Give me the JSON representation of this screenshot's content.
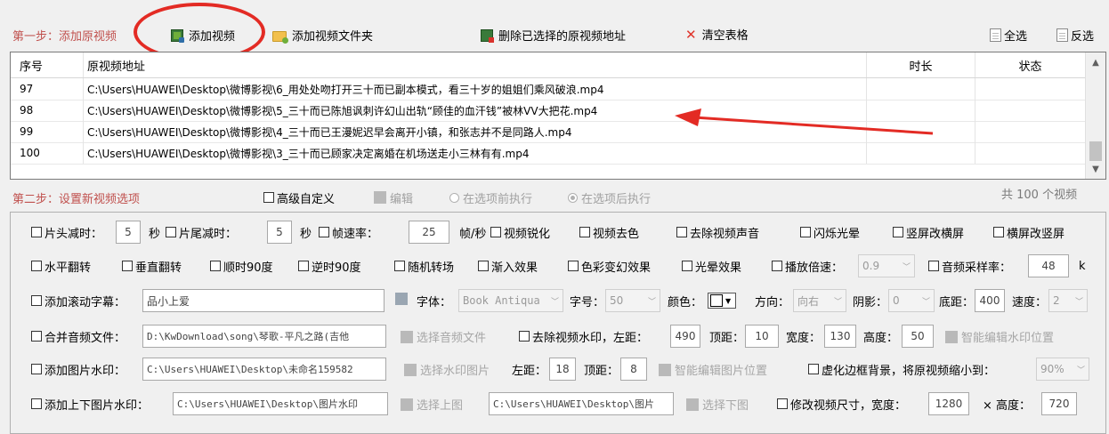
{
  "toolbar": {
    "step1_label": "第一步：添加原视频",
    "add_video": "添加视频",
    "add_folder": "添加视频文件夹",
    "delete_selected": "删除已选择的原视频地址",
    "clear_table": "清空表格",
    "select_all": "全选",
    "invert": "反选"
  },
  "table": {
    "headers": {
      "index": "序号",
      "path": "原视频地址",
      "duration": "时长",
      "status": "状态"
    },
    "rows": [
      {
        "index": "97",
        "path": "C:\\Users\\HUAWEI\\Desktop\\微博影视\\6_用处处吻打开三十而已副本模式，看三十岁的姐姐们乘风破浪.mp4",
        "duration": "",
        "status": ""
      },
      {
        "index": "98",
        "path": "C:\\Users\\HUAWEI\\Desktop\\微博影视\\5_三十而已陈旭讽刺许幻山出轨“顾佳的血汗钱”被林VV大把花.mp4",
        "duration": "",
        "status": ""
      },
      {
        "index": "99",
        "path": "C:\\Users\\HUAWEI\\Desktop\\微博影视\\4_三十而已王漫妮迟早会离开小镇，和张志并不是同路人.mp4",
        "duration": "",
        "status": ""
      },
      {
        "index": "100",
        "path": "C:\\Users\\HUAWEI\\Desktop\\微博影视\\3_三十而已顾家决定离婚在机场送走小三林有有.mp4",
        "duration": "",
        "status": ""
      }
    ]
  },
  "step2": {
    "label": "第二步：设置新视频选项",
    "advanced": "高级自定义",
    "edit": "编辑",
    "before": "在选项前执行",
    "after": "在选项后执行",
    "count": "共 100 个视频"
  },
  "options": {
    "head_trim": "片头减时：",
    "head_trim_val": "5",
    "sec1": "秒",
    "tail_trim": "片尾减时：",
    "tail_trim_val": "5",
    "sec2": "秒",
    "fps": "帧速率：",
    "fps_val": "25",
    "fps_unit": "帧/秒",
    "sharpen": "视频锐化",
    "decolor": "视频去色",
    "mute": "去除视频声音",
    "flash": "闪烁光晕",
    "v2h": "竖屏改横屏",
    "h2v": "横屏改竖屏",
    "hflip": "水平翻转",
    "vflip": "垂直翻转",
    "cw90": "顺时90度",
    "ccw90": "逆时90度",
    "random_trans": "随机转场",
    "fadein": "渐入效果",
    "color_fx": "色彩变幻效果",
    "light_fx": "光晕效果",
    "speed": "播放倍速：",
    "speed_val": "0.9",
    "sample_rate": "音频采样率：",
    "sample_rate_val": "48",
    "sample_unit": "k",
    "subtitle": "添加滚动字幕：",
    "subtitle_val": "品小上爱",
    "font_label": "字体：",
    "font_val": "Book Antiqua",
    "size_label": "字号：",
    "size_val": "50",
    "color_label": "颜色：",
    "dir_label": "方向：",
    "dir_val": "向右",
    "shadow_label": "阴影：",
    "shadow_val": "0",
    "bottom_label": "底距：",
    "bottom_val": "400",
    "speed2_label": "速度：",
    "speed2_val": "2",
    "merge_audio": "合并音频文件：",
    "merge_audio_val": "D:\\KwDownload\\song\\琴歌-平凡之路(吉他",
    "choose_audio": "选择音频文件",
    "remove_wm": "去除视频水印，左距：",
    "wm_left": "490",
    "top_label": "顶距：",
    "wm_top": "10",
    "width_label": "宽度：",
    "wm_width": "130",
    "height_label": "高度：",
    "wm_height": "50",
    "smart_wm": "智能编辑水印位置",
    "img_wm": "添加图片水印：",
    "img_wm_val": "C:\\Users\\HUAWEI\\Desktop\\未命名159582",
    "choose_wm_img": "选择水印图片",
    "left_label": "左距：",
    "img_left": "18",
    "top_label2": "顶距：",
    "img_top": "8",
    "smart_img": "智能编辑图片位置",
    "blur_border": "虚化边框背景，将原视频缩小到：",
    "blur_val": "90%",
    "top_bottom_wm": "添加上下图片水印：",
    "top_img_val": "C:\\Users\\HUAWEI\\Desktop\\图片水印",
    "choose_top": "选择上图",
    "bottom_img_val": "C:\\Users\\HUAWEI\\Desktop\\图片",
    "choose_bottom": "选择下图",
    "resize": "修改视频尺寸，宽度：",
    "resize_w": "1280",
    "times": "× 高度：",
    "resize_h": "720"
  },
  "colors": {
    "step": "#c0504d",
    "annotation": "#e32b24"
  }
}
